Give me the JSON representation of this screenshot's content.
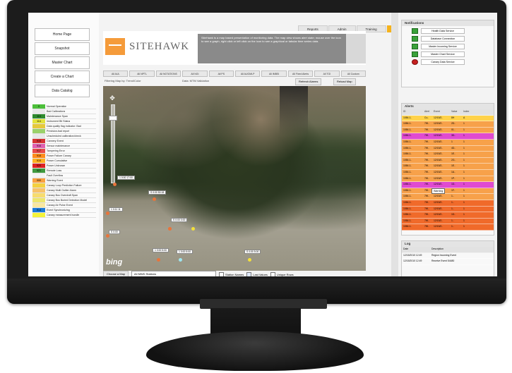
{
  "nav_buttons": [
    "Home Page",
    "Snapshot",
    "Master Chart",
    "Create a Chart",
    "Data Catalog"
  ],
  "legend": [
    {
      "code": "0",
      "label": "Normal Operation",
      "color": "#4cbf3a"
    },
    {
      "code": "",
      "label": "Bad Calibrations",
      "color": "#e9e9e9"
    },
    {
      "code": "113",
      "label": "Maintenance Span",
      "color": "#2e8b2e"
    },
    {
      "code": "114",
      "label": "Instrument Bit Status",
      "color": "#e3e33a"
    },
    {
      "code": "",
      "label": "Data quality flag indicator: Bad",
      "color": "#e6c93a"
    },
    {
      "code": "",
      "label": "Precision-bad report",
      "color": "#9bd16a"
    },
    {
      "code": "",
      "label": "Unscheduled calibration/check",
      "color": "#e8e8e8"
    },
    {
      "code": "915",
      "label": "Cannery Event",
      "color": "#d63232"
    },
    {
      "code": "916",
      "label": "Sensor maintenance",
      "color": "#e05fb0"
    },
    {
      "code": "917",
      "label": "Tampering Error",
      "color": "#e84a4a"
    },
    {
      "code": "918",
      "label": "Power Failure Canary",
      "color": "#ff8c1a"
    },
    {
      "code": "919",
      "label": "Power Cumulative",
      "color": "#ffb020"
    },
    {
      "code": "920",
      "label": "Power Unknown",
      "color": "#d22"
    },
    {
      "code": "921",
      "label": "Remote Loss",
      "color": "#3f9a3f"
    },
    {
      "code": "",
      "label": "Fault Overflow",
      "color": "#f3f3f3"
    },
    {
      "code": "999",
      "label": "Warning Event",
      "color": "#f9a03f"
    },
    {
      "code": "",
      "label": "Canary Loop Prediction Failure",
      "color": "#f4d03f"
    },
    {
      "code": "",
      "label": "Canary Multi Outlier Alarm",
      "color": "#f7c36a"
    },
    {
      "code": "",
      "label": "Canary Bus Overdraft Span",
      "color": "#f7dc6f"
    },
    {
      "code": "",
      "label": "Canary Bus Buried Detection Model",
      "color": "#ede66d"
    },
    {
      "code": "",
      "label": "Canary Air Pulse Event",
      "color": "#f9e79f"
    },
    {
      "code": "914",
      "label": "Event Synchronizing",
      "color": "#1a7ad6"
    },
    {
      "code": "",
      "label": "Canary measurement bundle",
      "color": "#f3f33a"
    }
  ],
  "header": {
    "logo": "SITEHAWK",
    "info": "SiteHawk is a map based presentation of monitoring data. The map view shows alert state; mouse over the icon to see a graph, right click or left click on the icon to see a graphical or tabular time series data."
  },
  "top_tabs": [
    "Reports",
    "Admin",
    "Training"
  ],
  "toolbar": [
    "All AUL",
    "All NPTL",
    "All NOTATIONS",
    "All NGI",
    "All PS",
    "All AUGMLP",
    "All IMBSI",
    "All Fixed Alerts",
    "All TGI",
    "All Custom"
  ],
  "map_info": {
    "left": "Filtering Map by: Trend/Color",
    "mid": "Data: MTM Validation",
    "refresh": "Refresh Alarms",
    "reload": "Reload Map"
  },
  "map_labels": [
    {
      "text": "1 0:00 17:00"
    },
    {
      "text": "S 0:00 50:18"
    },
    {
      "text": "1 0:11 11"
    },
    {
      "text": "S 0:00 0:00"
    },
    {
      "text": "1 0:00 5:00"
    },
    {
      "text": "S 0:00"
    },
    {
      "text": "1 0:00 5:00"
    },
    {
      "text": "S 0:00 5:00"
    }
  ],
  "map_footer": {
    "choose": "Choose a Map",
    "select": "All MWD Stations",
    "chk1": "Station Names",
    "chk2": "Last Values",
    "chk3": "Unique Rows"
  },
  "notifications": {
    "title": "Notifications",
    "services": [
      "Health Data Service",
      "Database Connection",
      "Master Incoming Service",
      "Master Chart Service",
      "Canary Data Service"
    ]
  },
  "alerts": {
    "title": "Alerts",
    "cols": [
      "ID",
      "Alert",
      "Event",
      "Value",
      "Index"
    ],
    "rows": [
      {
        "id": "1084.1..",
        "a": "Cu..",
        "e": "12/15/2..",
        "v": "8H",
        "i": "A",
        "color": "#ffd24a"
      },
      {
        "id": "1084.1..",
        "a": "7W..",
        "e": "12/15/2..",
        "v": "2D..",
        "i": "1",
        "color": "#f7a14a"
      },
      {
        "id": "1084.1..",
        "a": "7W..",
        "e": "12/15/2..",
        "v": "01..",
        "i": "1",
        "color": "#f7a14a"
      },
      {
        "id": "1084.1..",
        "a": "7W..",
        "e": "12/15/2..",
        "v": "3D..",
        "i": "1",
        "color": "#e04ad0"
      },
      {
        "id": "1084.1..",
        "a": "7W..",
        "e": "12/15/2..",
        "v": "1",
        "i": "1",
        "color": "#f7a14a"
      },
      {
        "id": "1084.1..",
        "a": "7W..",
        "e": "12/15/2..",
        "v": "4D..",
        "i": "1",
        "color": "#f7a14a"
      },
      {
        "id": "1084.1..",
        "a": "7W..",
        "e": "12/15/2..",
        "v": "1E..",
        "i": "1",
        "color": "#f7a14a"
      },
      {
        "id": "1084.1..",
        "a": "7W..",
        "e": "12/15/2..",
        "v": "2G..",
        "i": "1",
        "color": "#f7a14a"
      },
      {
        "id": "1084.1..",
        "a": "7W..",
        "e": "12/15/2..",
        "v": "1E..",
        "i": "1",
        "color": "#f7a14a"
      },
      {
        "id": "1084.1..",
        "a": "7W..",
        "e": "12/15/2..",
        "v": "1A..",
        "i": "1",
        "color": "#f7a14a"
      },
      {
        "id": "1084.1..",
        "a": "7W..",
        "e": "12/15/2..",
        "v": "1P..",
        "i": "1",
        "color": "#f7a14a"
      },
      {
        "id": "1084.1..",
        "a": "7W..",
        "e": "12/15/2..",
        "v": "1D..",
        "i": "1",
        "color": "#e04ad0"
      },
      {
        "id": "1084.1..",
        "a": "7W..",
        "e": "12/15/2..",
        "v": "1F..",
        "i": "1",
        "color": "#f7a14a"
      },
      {
        "id": "1084.1..",
        "a": "7W..",
        "e": "12/15/2..",
        "v": "1..",
        "i": "1",
        "color": "#f7a14a"
      },
      {
        "id": "1084.1..",
        "a": "7W..",
        "e": "12/15/2..",
        "v": "1..",
        "i": "1",
        "color": "#f06a2a"
      },
      {
        "id": "1084.1..",
        "a": "7W..",
        "e": "12/15/2..",
        "v": "1..",
        "i": "1",
        "color": "#f06a2a"
      },
      {
        "id": "1084.1..",
        "a": "7W..",
        "e": "12/15/2..",
        "v": "1D..",
        "i": "1",
        "color": "#f06a2a"
      },
      {
        "id": "1084.1..",
        "a": "7W..",
        "e": "12/15/2..",
        "v": "1..",
        "i": "1",
        "color": "#f06a2a"
      },
      {
        "id": "1084.1..",
        "a": "7W..",
        "e": "12/15/2..",
        "v": "1..",
        "i": "1",
        "color": "#f06a2a"
      }
    ],
    "tooltip": "Warning"
  },
  "log": {
    "title": "Log",
    "cols": [
      "Date",
      "Description"
    ],
    "rows": [
      {
        "d": "12/15/2010 12:49",
        "t": "Region Incoming Event"
      },
      {
        "d": "12/15/2010 12:49",
        "t": "Receive Event 54480"
      }
    ]
  }
}
